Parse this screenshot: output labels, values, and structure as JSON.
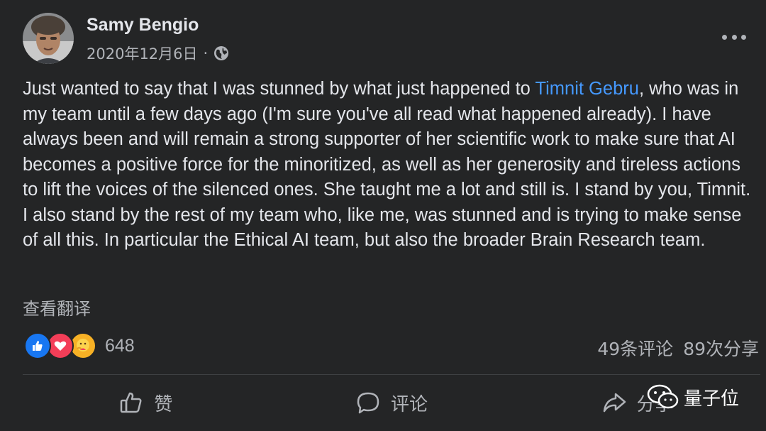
{
  "post": {
    "author": "Samy Bengio",
    "date": "2020年12月6日",
    "separator": "·",
    "body_before": "Just wanted to say that I was stunned by what just happened to ",
    "mention": "Timnit Gebru",
    "body_after": ", who was in my team until a few days ago (I'm sure you've all read what happened already). I have always been and will remain a strong supporter of her scientific work to make sure that AI becomes a positive force for the minoritized, as well as her generosity and tireless actions to lift the voices of the silenced ones. She taught me a lot and still is. I stand by you, Timnit. I also stand by the rest of my team who, like me, was stunned and is trying to make sense of all this. In particular the Ethical AI team, but also the broader Brain Research team.",
    "translate_label": "查看翻译"
  },
  "engagement": {
    "reaction_count": "648",
    "comments": "49条评论",
    "shares": "89次分享",
    "reaction_icons": [
      "like-icon",
      "love-icon",
      "care-icon"
    ]
  },
  "actions": {
    "like_label": "赞",
    "comment_label": "评论",
    "share_label": "分享"
  },
  "watermark": {
    "text": "量子位"
  },
  "colors": {
    "background": "#242526",
    "text": "#e4e6eb",
    "secondary": "#b0b3b8",
    "link": "#4599ff",
    "like": "#1877f2",
    "love": "#f33e58",
    "care": "#f7b125"
  }
}
